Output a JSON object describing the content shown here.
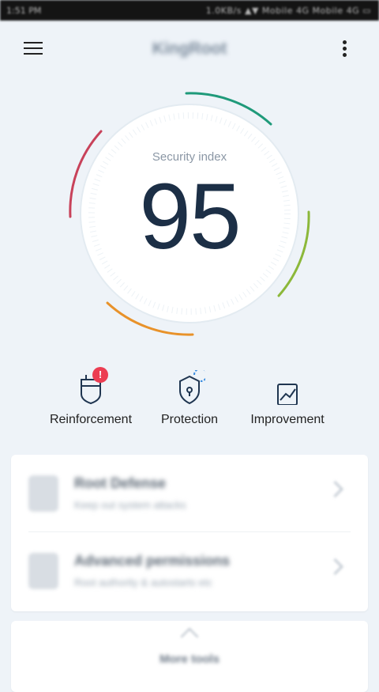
{
  "status_bar": {
    "left_text": "1:51 PM",
    "right_text": "1.0KB/s  ▲▼  Mobile 4G  Mobile 4G  ▭"
  },
  "header": {
    "title": "KingRoot"
  },
  "gauge": {
    "label": "Security index",
    "value": "95",
    "arc_colors": {
      "red": "#c8425a",
      "orange": "#e8922a",
      "green_yellow": "#8cb83a",
      "teal": "#1f9a7a"
    }
  },
  "features": [
    {
      "label": "Reinforcement",
      "icon": "plug-shield-icon",
      "badge": "!"
    },
    {
      "label": "Protection",
      "icon": "shield-lock-icon"
    },
    {
      "label": "Improvement",
      "icon": "chart-icon"
    }
  ],
  "list": [
    {
      "title": "Root Defense",
      "subtitle": "Keep out system attacks"
    },
    {
      "title": "Advanced permissions",
      "subtitle": "Root authority & autostarts etc"
    }
  ],
  "more_tools": {
    "label": "More tools"
  },
  "colors": {
    "accent_badge": "#ec3d52",
    "value_text": "#1c2f46",
    "background": "#eef3f8"
  }
}
